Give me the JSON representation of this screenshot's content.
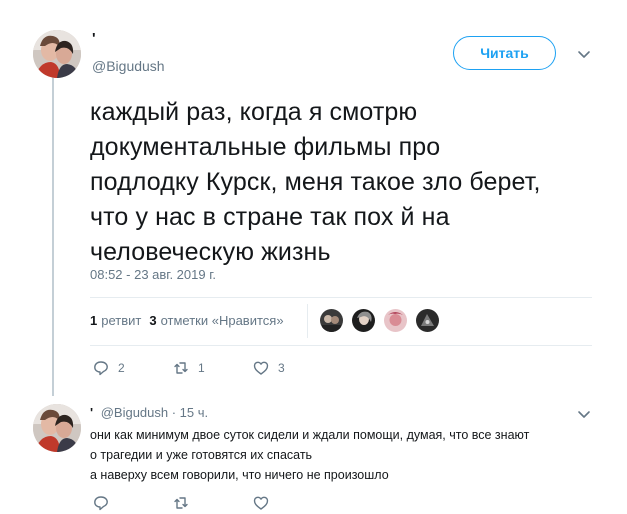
{
  "tweet": {
    "display_name": "'",
    "handle": "@Bigudush",
    "follow_label": "Читать",
    "text": "каждый раз, когда я смотрю\nдокументальные фильмы про\nподлодку Курск, меня такое зло берет,\nчто у нас в стране так пох   й на\nчеловеческую жизнь",
    "timestamp": "08:52 - 23 авг. 2019 г.",
    "retweets_count": "1",
    "retweets_label": "ретвит",
    "likes_count": "3",
    "likes_label": "отметки «Нравится»",
    "actions": {
      "replies": "2",
      "retweets": "1",
      "likes": "3"
    }
  },
  "reply": {
    "display_name": "'",
    "handle_time": "@Bigudush · 15 ч.",
    "text": "они как минимум двое суток сидели и ждали помощи, думая, что все знают\nо трагедии и уже готовятся их спасать\nа наверху всем говорили, что ничего не произошло",
    "actions": {
      "replies": "",
      "retweets": "",
      "likes": ""
    }
  },
  "colors": {
    "accent": "#1da1f2",
    "secondary_text": "#657786",
    "divider": "#e6ecf0"
  },
  "icons": [
    "chevron-down-icon",
    "reply-icon",
    "retweet-icon",
    "heart-icon"
  ]
}
